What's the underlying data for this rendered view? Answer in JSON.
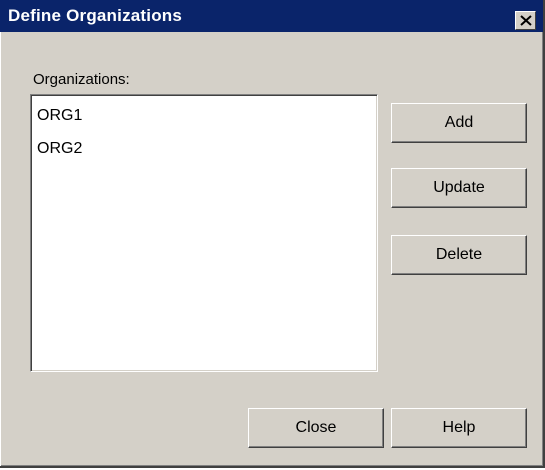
{
  "window": {
    "title": "Define Organizations",
    "close_icon": "close-icon"
  },
  "organizations": {
    "label": "Organizations:",
    "items": [
      "ORG1",
      "ORG2"
    ]
  },
  "buttons": {
    "add": "Add",
    "update": "Update",
    "delete": "Delete",
    "close": "Close",
    "help": "Help"
  },
  "colors": {
    "titlebar": "#0a246a",
    "dialog_face": "#d4d0c8",
    "list_background": "#ffffff"
  }
}
